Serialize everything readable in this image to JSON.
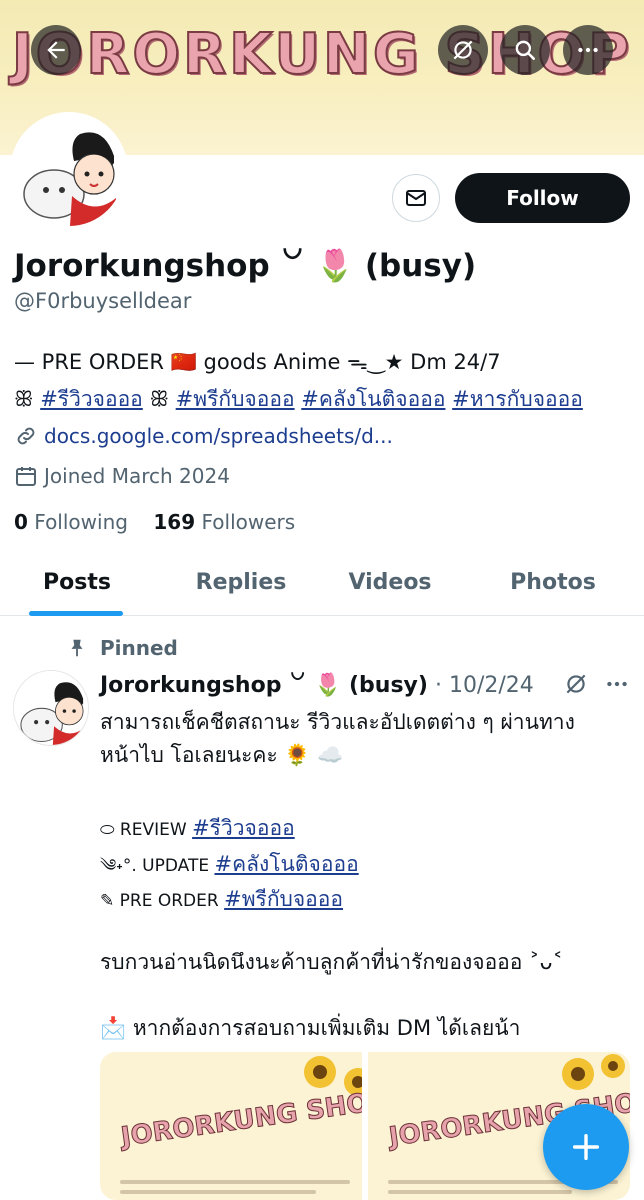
{
  "banner": {
    "title": "JORORKUNG SHOP"
  },
  "profile": {
    "display_name": "Jororkungshop ꒡ 🌷 (busy)",
    "handle": "@F0rbuyselldear",
    "bio_line1": "— PRE ORDER 🇨🇳 goods Anime ᯓ‿★ Dm 24/7",
    "bio_line2_prefix": "ꕥ",
    "bio_tags": [
      "#รีวิวจอออ",
      "#พรีกับจอออ",
      "#คลังโนติจอออ",
      "#หารกับจอออ"
    ],
    "bio_line2_sep": "ꕥ",
    "website": "docs.google.com/spreadsheets/d...",
    "joined": "Joined March 2024",
    "following_count": "0",
    "following_label": "Following",
    "followers_count": "169",
    "followers_label": "Followers"
  },
  "actions": {
    "follow_label": "Follow"
  },
  "tabs": [
    {
      "label": "Posts"
    },
    {
      "label": "Replies"
    },
    {
      "label": "Videos"
    },
    {
      "label": "Photos"
    }
  ],
  "post": {
    "pinned_label": "Pinned",
    "author": "Jororkungshop ꒡ 🌷 (busy)",
    "date_sep": "·",
    "date": "10/2/24",
    "line1": "สามารถเช็คชีตสถานะ รีวิวและอัปเดตต่าง ๆ ผ่านทาง",
    "line2": "หน้าไบ โอเลยนะคะ 🌻 ☁️",
    "review_prefix": "⬭ REVIEW",
    "review_tag": "#รีวิวจอออ",
    "update_prefix": "༄˖°. UPDATE",
    "update_tag": "#คลังโนติจอออ",
    "preorder_prefix": "✎ PRE ORDER",
    "preorder_tag": "#พรีกับจอออ",
    "line3": "รบกวนอ่านนิดนึงนะค้าบลูกค้าที่น่ารักของจอออ ˃ᴗ˂",
    "line4": "📩 หากต้องการสอบถามเพิ่มเติม DM ได้เลยน้า",
    "media_titles": [
      "JORORKUNG SHOP",
      "JORORKUNG SHOP"
    ]
  },
  "colors": {
    "accent": "#1d9bf0",
    "link": "#1d3d8f",
    "follow_bg": "#0f1419",
    "banner": "#f3eab4"
  },
  "icons": [
    "back-arrow-icon",
    "mute-icon",
    "search-icon",
    "more-icon",
    "mail-icon",
    "link-icon",
    "calendar-icon",
    "pin-icon",
    "compose-plus-icon"
  ]
}
